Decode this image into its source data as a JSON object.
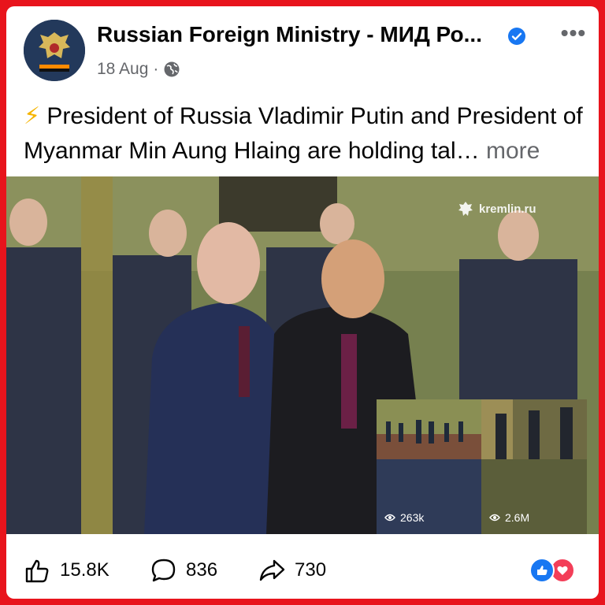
{
  "post": {
    "page_name": "Russian Foreign Ministry - МИД Ро...",
    "date": "18 Aug",
    "separator": "·",
    "audience_icon": "globe-icon",
    "verified_icon": "verified-badge-icon",
    "menu_icon": "more-options-icon",
    "menu_label": "•••",
    "emoji": "⚡",
    "text": "President of Russia Vladimir Putin and President of Myanmar Min Aung Hlaing are holding tal…",
    "more_label": "more"
  },
  "media": {
    "watermark": "kremlin.ru",
    "thumbnails": [
      {
        "views": "263k"
      },
      {
        "views": "2.6M"
      }
    ]
  },
  "footer": {
    "like_count": "15.8K",
    "comment_count": "836",
    "share_count": "730",
    "reaction_icons": [
      "like-reaction-icon",
      "love-reaction-icon"
    ]
  },
  "colors": {
    "frame": "#e8141c",
    "verified": "#1877f2",
    "text": "#050505",
    "meta": "#65676b"
  }
}
